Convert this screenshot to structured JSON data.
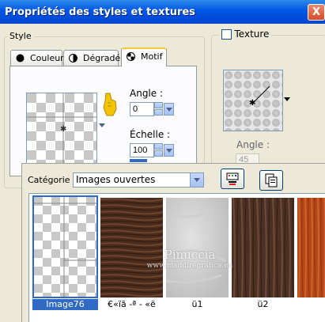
{
  "window": {
    "title": "Propriétés des styles et textures",
    "close_label": "X"
  },
  "style_group": {
    "legend": "Style",
    "tabs": [
      {
        "label": "Couleur",
        "icon": "color-dot-icon",
        "active": false
      },
      {
        "label": "Dégradé",
        "icon": "gradient-icon",
        "active": false
      },
      {
        "label": "Motif",
        "icon": "pattern-icon",
        "active": true
      }
    ],
    "angle_label": "Angle :",
    "angle_value": "0",
    "scale_label": "Échelle :",
    "scale_value": "100"
  },
  "texture_group": {
    "checkbox_label": "Texture",
    "checked": false,
    "angle_label": "Angle :",
    "angle_value": "45"
  },
  "category": {
    "label": "Catégorie :",
    "selected": "Images ouvertes"
  },
  "thumbnails": [
    {
      "name": "Image76",
      "selected": true,
      "kind": "checker"
    },
    {
      "name": "€«ïã -ª - «ë",
      "selected": false,
      "kind": "dark-wood"
    },
    {
      "name": "ü1",
      "selected": false,
      "kind": "grey-marble"
    },
    {
      "name": "ü2",
      "selected": false,
      "kind": "brown-wood"
    },
    {
      "name": "",
      "selected": false,
      "kind": "orange-wood"
    }
  ],
  "watermark": {
    "line1": "Pinuccia",
    "line2": "www.maddiregrafica.eu"
  },
  "colors": {
    "titlebar": "#0055e5",
    "selection": "#316ac5",
    "dialog_bg": "#ece9d8"
  }
}
